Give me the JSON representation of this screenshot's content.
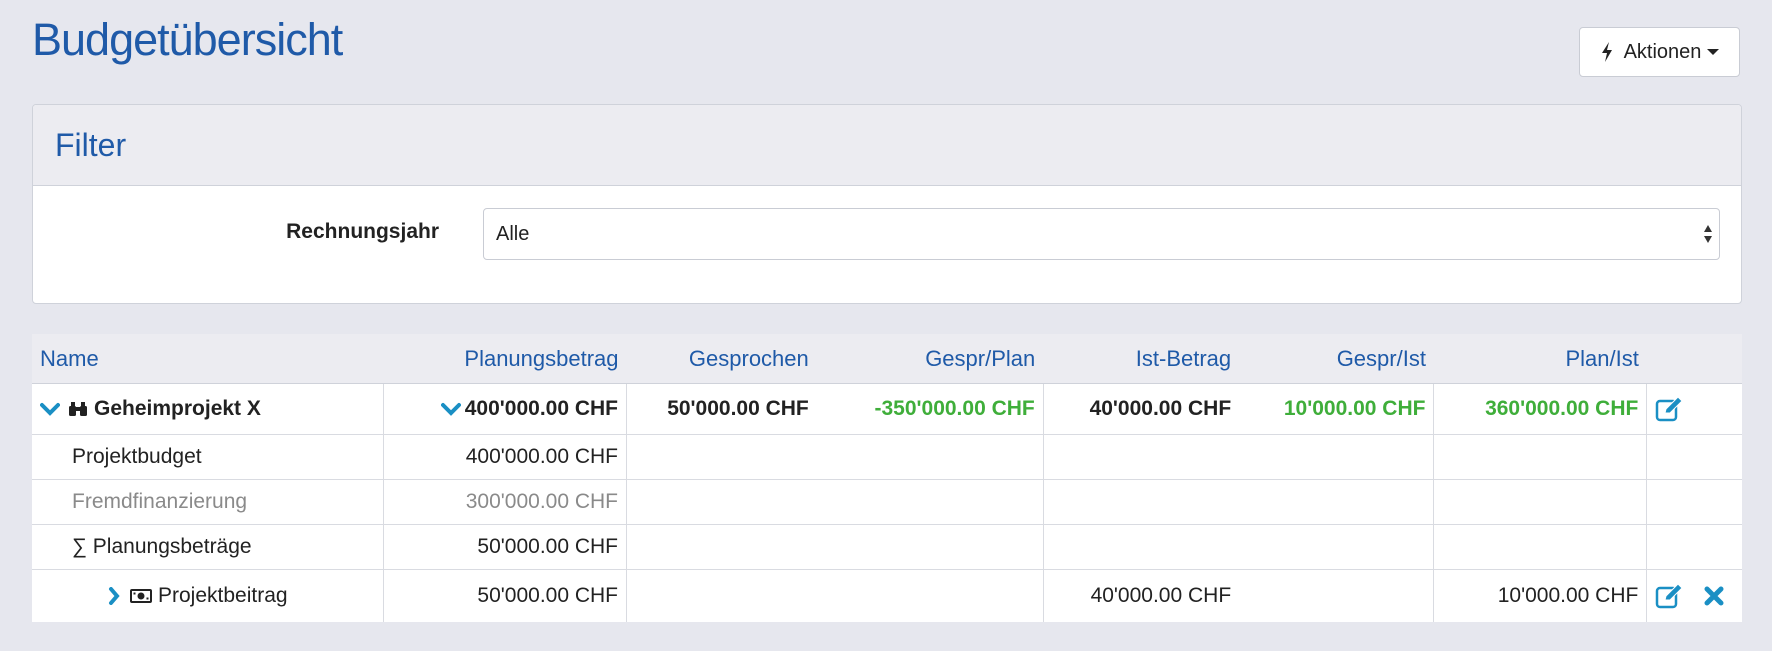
{
  "header": {
    "title": "Budgetübersicht",
    "actions_label": "Aktionen"
  },
  "filter": {
    "title": "Filter",
    "label": "Rechnungsjahr",
    "selected": "Alle"
  },
  "table": {
    "columns": [
      "Name",
      "Planungsbetrag",
      "Gesprochen",
      "Gespr/Plan",
      "Ist-Betrag",
      "Gespr/Ist",
      "Plan/Ist"
    ],
    "project": {
      "name": "Geheimprojekt X",
      "planungsbetrag": "400'000.00 CHF",
      "gesprochen": "50'000.00 CHF",
      "gespr_plan": "-350'000.00 CHF",
      "ist_betrag": "40'000.00 CHF",
      "gespr_ist": "10'000.00 CHF",
      "plan_ist": "360'000.00 CHF"
    },
    "sub_rows": [
      {
        "name": "Projektbudget",
        "planungsbetrag": "400'000.00 CHF"
      },
      {
        "name": "Fremdfinanzierung",
        "planungsbetrag": "300'000.00 CHF"
      },
      {
        "name": "∑ Planungsbeträge",
        "planungsbetrag": "50'000.00 CHF"
      }
    ],
    "beitrag": {
      "name": "Projektbeitrag",
      "planungsbetrag": "50'000.00 CHF",
      "ist_betrag": "40'000.00 CHF",
      "plan_ist": "10'000.00 CHF"
    }
  },
  "colors": {
    "accent": "#1f5aa8",
    "icon_teal": "#1a8fc4",
    "positive_green": "#3fae3a",
    "muted": "#8a8a8a"
  }
}
